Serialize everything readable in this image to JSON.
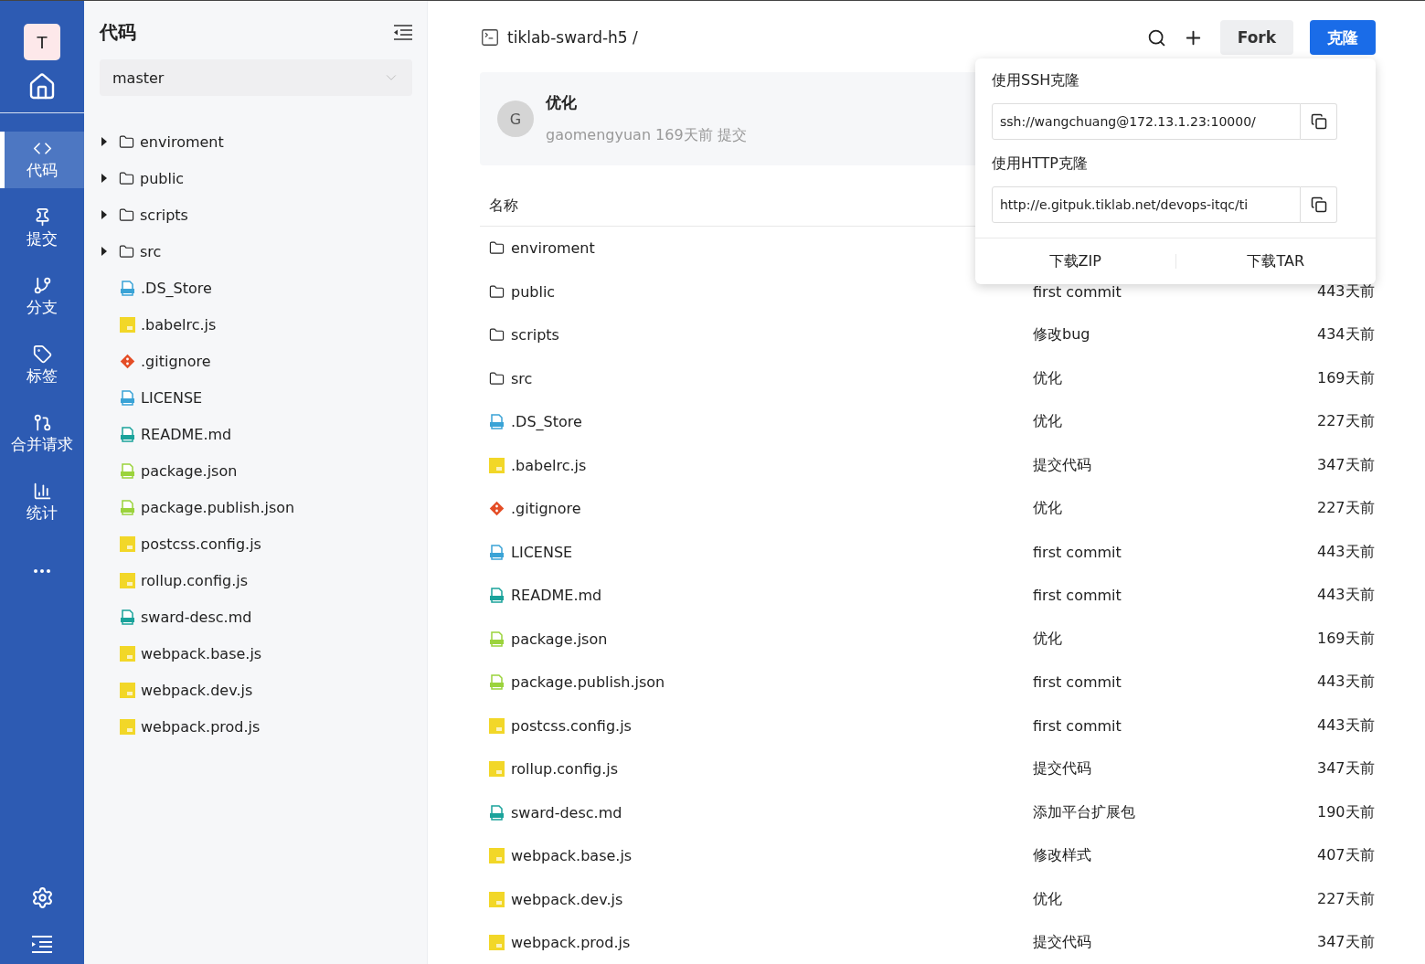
{
  "nav": {
    "avatar": "T",
    "items": [
      {
        "label": "代码",
        "selected": true
      },
      {
        "label": "提交",
        "selected": false
      },
      {
        "label": "分支",
        "selected": false
      },
      {
        "label": "标签",
        "selected": false
      },
      {
        "label": "合并请求",
        "selected": false
      },
      {
        "label": "统计",
        "selected": false
      }
    ]
  },
  "sidebar": {
    "title": "代码",
    "branch": "master",
    "tree": [
      {
        "name": "enviroment",
        "kind": "folder",
        "expanded": false
      },
      {
        "name": "public",
        "kind": "folder",
        "expanded": false
      },
      {
        "name": "scripts",
        "kind": "folder",
        "expanded": false
      },
      {
        "name": "src",
        "kind": "folder",
        "expanded": false
      },
      {
        "name": ".DS_Store",
        "kind": "doc"
      },
      {
        "name": ".babelrc.js",
        "kind": "js"
      },
      {
        "name": ".gitignore",
        "kind": "git"
      },
      {
        "name": "LICENSE",
        "kind": "doc"
      },
      {
        "name": "README.md",
        "kind": "md"
      },
      {
        "name": "package.json",
        "kind": "json"
      },
      {
        "name": "package.publish.json",
        "kind": "json"
      },
      {
        "name": "postcss.config.js",
        "kind": "js"
      },
      {
        "name": "rollup.config.js",
        "kind": "js"
      },
      {
        "name": "sward-desc.md",
        "kind": "md"
      },
      {
        "name": "webpack.base.js",
        "kind": "js"
      },
      {
        "name": "webpack.dev.js",
        "kind": "js"
      },
      {
        "name": "webpack.prod.js",
        "kind": "js"
      }
    ]
  },
  "header": {
    "repo": "tiklab-sward-h5 /",
    "fork": "Fork",
    "clone": "克隆"
  },
  "last_commit": {
    "avatar": "G",
    "message": "优化",
    "meta": "gaomengyuan 169天前 提交"
  },
  "table": {
    "columns": [
      "名称"
    ],
    "rows": [
      {
        "name": "enviroment",
        "kind": "folder"
      },
      {
        "name": "public",
        "kind": "folder",
        "commit": "first commit",
        "time": "443天前"
      },
      {
        "name": "scripts",
        "kind": "folder",
        "commit": "修改bug",
        "time": "434天前"
      },
      {
        "name": "src",
        "kind": "folder",
        "commit": "优化",
        "time": "169天前"
      },
      {
        "name": ".DS_Store",
        "kind": "doc",
        "commit": "优化",
        "time": "227天前"
      },
      {
        "name": ".babelrc.js",
        "kind": "js",
        "commit": "提交代码",
        "time": "347天前"
      },
      {
        "name": ".gitignore",
        "kind": "git",
        "commit": "优化",
        "time": "227天前"
      },
      {
        "name": "LICENSE",
        "kind": "doc",
        "commit": "first commit",
        "time": "443天前"
      },
      {
        "name": "README.md",
        "kind": "md",
        "commit": "first commit",
        "time": "443天前"
      },
      {
        "name": "package.json",
        "kind": "json",
        "commit": "优化",
        "time": "169天前"
      },
      {
        "name": "package.publish.json",
        "kind": "json",
        "commit": "first commit",
        "time": "443天前"
      },
      {
        "name": "postcss.config.js",
        "kind": "js",
        "commit": "first commit",
        "time": "443天前"
      },
      {
        "name": "rollup.config.js",
        "kind": "js",
        "commit": "提交代码",
        "time": "347天前"
      },
      {
        "name": "sward-desc.md",
        "kind": "md",
        "commit": "添加平台扩展包",
        "time": "190天前"
      },
      {
        "name": "webpack.base.js",
        "kind": "js",
        "commit": "修改样式",
        "time": "407天前"
      },
      {
        "name": "webpack.dev.js",
        "kind": "js",
        "commit": "优化",
        "time": "227天前"
      },
      {
        "name": "webpack.prod.js",
        "kind": "js",
        "commit": "提交代码",
        "time": "347天前"
      }
    ]
  },
  "clone_popup": {
    "ssh_label": "使用SSH克隆",
    "ssh_url": "ssh://wangchuang@172.13.1.23:10000/",
    "http_label": "使用HTTP克隆",
    "http_url": "http://e.gitpuk.tiklab.net/devops-itqc/ti",
    "download_zip": "下载ZIP",
    "download_tar": "下载TAR"
  }
}
